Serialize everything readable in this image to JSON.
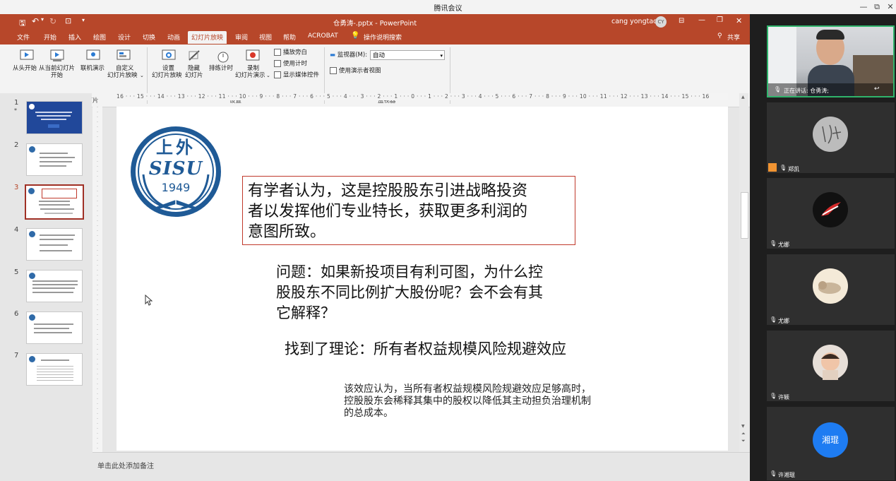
{
  "meeting": {
    "title": "腾讯会议",
    "controls": [
      "minimize",
      "restore",
      "close"
    ]
  },
  "ppt": {
    "window_title": "仓勇涛-.pptx  -  PowerPoint",
    "user": "cang yongtao",
    "user_initials": "CY",
    "tabs": [
      "文件",
      "开始",
      "插入",
      "绘图",
      "设计",
      "切换",
      "动画",
      "幻灯片放映",
      "审阅",
      "视图",
      "帮助",
      "ACROBAT",
      "操作说明搜索"
    ],
    "share_label": "共享",
    "ribbon": {
      "start_group": {
        "from_beginning": "从头开始",
        "from_current_1": "从当前幻灯片",
        "from_current_2": "开始",
        "online_present": "联机演示",
        "custom_1": "自定义",
        "custom_2": "幻灯片放映",
        "group_label": "开始放映幻灯片"
      },
      "setup_group": {
        "setup_1": "设置",
        "setup_2": "幻灯片放映",
        "hide_1": "隐藏",
        "hide_2": "幻灯片",
        "rehearse": "排练计时",
        "record_1": "录制",
        "record_2": "幻灯片演示",
        "play_narrations": "播放旁白",
        "use_timings": "使用计时",
        "show_media_controls": "显示媒体控件",
        "group_label": "设置"
      },
      "monitors_group": {
        "monitor_label": "监视器(M):",
        "monitor_value": "自动",
        "presenter_view": "使用演示者视图",
        "group_label": "监视器"
      }
    },
    "ruler_text": "16 · · · 15 · · · 14 · · · 13 · · · 12 · · · 11 · · · 10 · · · 9 · · · 8 · · · 7 · · · 6 · · · 5 · · · 4 · · · 3 · · · 2 · · · 1 · · · 0 · · · 1 · · · 2 · · · 3 · · · 4 · · · 5 · · · 6 · · · 7 · · · 8 · · · 9 · · · 10 · · · 11 · · · 12 · · · 13 · · · 14 · · · 15 · · · 16",
    "thumbnails": [
      {
        "num": "1",
        "star": "*"
      },
      {
        "num": "2"
      },
      {
        "num": "3"
      },
      {
        "num": "4"
      },
      {
        "num": "5"
      },
      {
        "num": "6"
      },
      {
        "num": "7"
      }
    ],
    "selected_slide": "3",
    "slide": {
      "logo_top": "上外",
      "logo_mid": "SISU",
      "logo_year": "1949",
      "box_text_1": "有学者认为，这是控股股东引进战略投资",
      "box_text_2": "者以发挥他们专业特长，获取更多利润的",
      "box_text_3": "意图所致。",
      "question_1": "问题：如果新投项目有利可图，为什么控",
      "question_2": "股股东不同比例扩大股份呢？会不会有其",
      "question_3": "它解释？",
      "theory": "找到了理论：所有者权益规模风险规避效应",
      "effect_1": "该效应认为，当所有者权益规模风险规避效应足够高时，",
      "effect_2": "控股股东会稀释其集中的股权以降低其主动担负治理机制",
      "effect_3": "的总成本。"
    },
    "notes_placeholder": "单击此处添加备注"
  },
  "participants": [
    {
      "name": "仓勇涛",
      "speaking_label": "正在讲话: 仓勇涛;"
    },
    {
      "name": "郑凯"
    },
    {
      "name": "尤娜"
    },
    {
      "name": "尤娜"
    },
    {
      "name": "许颖"
    },
    {
      "name": "许湘琨",
      "avatar_text": "湘琨"
    }
  ],
  "colors": {
    "ppt_accent": "#b7472a",
    "slide_box_border": "#c0392b",
    "logo_blue": "#1f5a96",
    "avatar_blue": "#1e7cf2"
  }
}
